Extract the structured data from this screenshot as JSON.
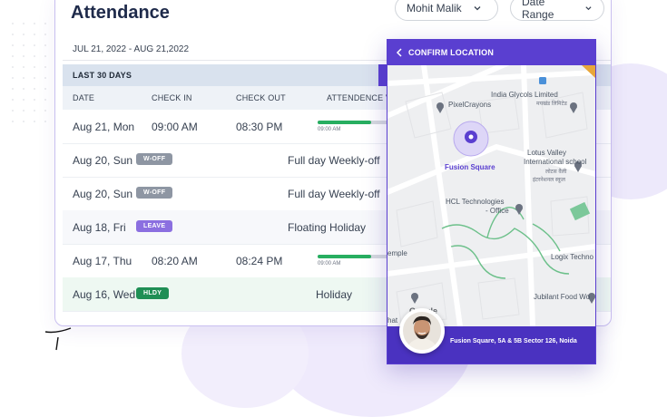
{
  "page": {
    "title": "Attendance"
  },
  "filters": {
    "employee": "Mohit Malik",
    "date_range": "Date Range"
  },
  "range_label": "JUL 21, 2022 - AUG 21,2022",
  "section_label": "LAST 30 DAYS",
  "table": {
    "headers": [
      "DATE",
      "CHECK IN",
      "CHECK OUT",
      "ATTENDENCE V"
    ],
    "rows": [
      {
        "date": "Aug 21, Mon",
        "check_in": "09:00 AM",
        "check_out": "08:30 PM",
        "bar_label": "09:00 AM",
        "progress": 0.65
      },
      {
        "date": "Aug 20, Sun",
        "badge": "W-OFF",
        "note": "Full day Weekly-off"
      },
      {
        "date": "Aug 20, Sun",
        "badge": "W-OFF",
        "note": "Full day Weekly-off"
      },
      {
        "date": "Aug 18, Fri",
        "badge": "LEAVE",
        "note": "Floating Holiday"
      },
      {
        "date": "Aug 17, Thu",
        "check_in": "08:20 AM",
        "check_out": "08:24 PM",
        "bar_label": "09:00 AM",
        "progress": 0.65
      },
      {
        "date": "Aug 16, Wed",
        "badge": "HLDY",
        "note": "Holiday"
      }
    ]
  },
  "phone": {
    "header": "CONFIRM LOCATION",
    "footer": "Fusion Square, 5A & 5B Sector 126, Noida",
    "map_labels": {
      "pixelcrayons": "PixelCrayons",
      "india_glycols": "India Glycols Limited",
      "india_glycols_hi": "मयखंड लिमिटेड",
      "fusion": "Fusion Square",
      "lotus1": "Lotus Valley",
      "lotus2": "International school",
      "lotus_hi": "लोटस वैली",
      "lotus_hi2": "इंटरनेशनल स्कूल",
      "hcl1": "HCL Technologies",
      "hcl2": "- Office",
      "temple": "emple",
      "logix": "Logix Techno",
      "jubilant": "Jubilant Food Wo",
      "google": "Google",
      "bottom_left": "hat"
    }
  },
  "colors": {
    "accent": "#5a3fd0",
    "progress": "#27ae60",
    "hldy": "#1f8f55",
    "leave": "#8b6fe0",
    "woff": "#8e96a3"
  }
}
